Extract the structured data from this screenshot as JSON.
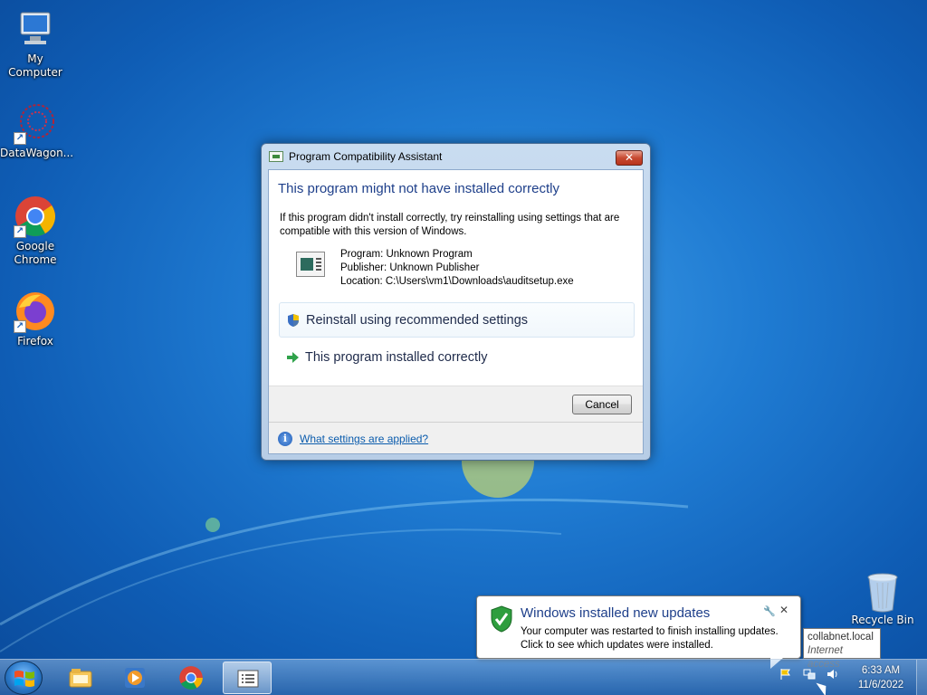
{
  "desktop": {
    "icons": [
      {
        "label": "My Computer",
        "icon": "computer-icon"
      },
      {
        "label": "DataWagon...",
        "icon": "datawagon-icon"
      },
      {
        "label": "Google Chrome",
        "icon": "chrome-icon"
      },
      {
        "label": "Firefox",
        "icon": "firefox-icon"
      }
    ],
    "recycle_bin": {
      "label": "Recycle Bin",
      "icon": "recycle-bin-icon"
    }
  },
  "dialog": {
    "title": "Program Compatibility Assistant",
    "heading": "This program might not have installed correctly",
    "description": "If this program didn't install correctly, try reinstalling using settings that are compatible with this version of Windows.",
    "program": "Program: Unknown Program",
    "publisher": "Publisher: Unknown Publisher",
    "location": "Location: C:\\Users\\vm1\\Downloads\\auditsetup.exe",
    "option_reinstall": "Reinstall using recommended settings",
    "option_correct": "This program installed correctly",
    "cancel_label": "Cancel",
    "help_link": "What settings are applied?",
    "close_glyph": "✕"
  },
  "notification": {
    "title": "Windows installed new updates",
    "line1": "Your computer was restarted to finish installing updates.",
    "line2": "Click to see which updates were installed.",
    "close_glyph": "✕"
  },
  "tooltip": {
    "line1": "collabnet.local",
    "line2": "Internet access"
  },
  "taskbar": {
    "pinned": [
      {
        "icon": "explorer-icon"
      },
      {
        "icon": "media-player-icon"
      },
      {
        "icon": "chrome-icon"
      },
      {
        "icon": "compatibility-assistant-icon",
        "active": true
      }
    ],
    "clock_time": "6:33 AM",
    "clock_date": "11/6/2022"
  },
  "colors": {
    "heading_blue": "#1e3f8a",
    "link_blue": "#0b5cad",
    "close_red": "#c74a32"
  }
}
